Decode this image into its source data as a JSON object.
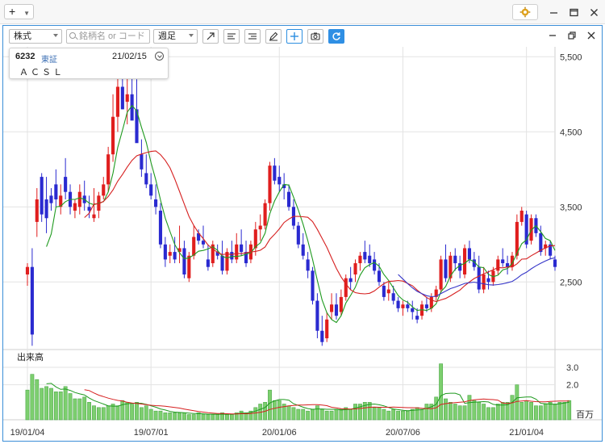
{
  "app": {
    "add_label": "+",
    "colors": {
      "accent": "#3b8ed8",
      "up": "#e01e1e",
      "down": "#2a2ad0",
      "ma_short": "#1f9a1f",
      "ma_mid": "#d62020",
      "ma_long": "#3535c8",
      "volume": "#7dcf6f"
    },
    "icons": [
      "add-icon",
      "chevron-down-icon",
      "gear-icon",
      "minimize-icon",
      "maximize-icon",
      "close-icon"
    ]
  },
  "toolbar": {
    "market_type": "株式",
    "search_placeholder": "銘柄名 or コード",
    "period": "週足",
    "tool_icons": [
      "trend-line-icon",
      "align-left-icon",
      "align-right-icon",
      "pencil-icon",
      "crosshair-icon",
      "camera-icon",
      "refresh-icon"
    ]
  },
  "info": {
    "code": "6232",
    "market": "東証",
    "date": "21/02/15",
    "name": "ＡＣＳＬ"
  },
  "volume_panel": {
    "label": "出来高",
    "unit": "百万",
    "y_ticks": [
      "3.0",
      "2.0"
    ]
  },
  "chart_data": {
    "type": "candlestick",
    "price_axis_ticks": [
      5500,
      4500,
      3500,
      2500
    ],
    "price_axis_labels": [
      "5,500",
      "4,500",
      "3,500",
      "2,500"
    ],
    "price_range": [
      1600,
      5600
    ],
    "x_tick_labels": [
      "19/01/04",
      "19/07/01",
      "20/01/06",
      "20/07/06",
      "21/01/04"
    ],
    "x_tick_index": [
      0,
      26,
      53,
      79,
      105
    ],
    "candles": [
      [
        2600,
        2750,
        2450,
        2700
      ],
      [
        2700,
        2950,
        1650,
        1800
      ],
      [
        3300,
        3750,
        3100,
        3600
      ],
      [
        3900,
        3950,
        3300,
        3400
      ],
      [
        3600,
        3900,
        3150,
        3350
      ],
      [
        3650,
        3750,
        3450,
        3550
      ],
      [
        3800,
        4000,
        3500,
        3600
      ],
      [
        3500,
        3800,
        3400,
        3650
      ],
      [
        3900,
        4150,
        3600,
        3700
      ],
      [
        3700,
        3800,
        3400,
        3500
      ],
      [
        3450,
        3600,
        3350,
        3550
      ],
      [
        3500,
        3800,
        3400,
        3700
      ],
      [
        3650,
        3850,
        3450,
        3550
      ],
      [
        3500,
        3650,
        3350,
        3450
      ],
      [
        3350,
        3750,
        3300,
        3400
      ],
      [
        3450,
        3700,
        3350,
        3650
      ],
      [
        3650,
        3900,
        3600,
        3800
      ],
      [
        3800,
        4300,
        3700,
        4200
      ],
      [
        4200,
        5000,
        4100,
        4700
      ],
      [
        4700,
        5400,
        4500,
        5100
      ],
      [
        5100,
        5600,
        4800,
        4800
      ],
      [
        4900,
        5400,
        4600,
        5000
      ],
      [
        5000,
        5500,
        4700,
        4650
      ],
      [
        4800,
        5200,
        4500,
        4350
      ],
      [
        4200,
        4400,
        3900,
        4000
      ],
      [
        3950,
        4200,
        3750,
        3800
      ],
      [
        3800,
        3950,
        3600,
        3650
      ],
      [
        3600,
        3800,
        3400,
        3500
      ],
      [
        3450,
        3550,
        2950,
        3000
      ],
      [
        3000,
        3100,
        2700,
        2800
      ],
      [
        2850,
        3000,
        2750,
        2900
      ],
      [
        2900,
        3100,
        2750,
        2800
      ],
      [
        2900,
        3250,
        2750,
        2950
      ],
      [
        2950,
        3050,
        2550,
        2600
      ],
      [
        2550,
        2900,
        2500,
        2850
      ],
      [
        2850,
        3250,
        2800,
        3100
      ],
      [
        3150,
        3200,
        3000,
        3050
      ],
      [
        3050,
        3250,
        2950,
        3000
      ],
      [
        2800,
        3000,
        2650,
        2700
      ],
      [
        2750,
        3050,
        2700,
        3000
      ],
      [
        2900,
        3000,
        2800,
        2850
      ],
      [
        2850,
        3050,
        2600,
        2650
      ],
      [
        2650,
        2950,
        2600,
        2900
      ],
      [
        2900,
        3050,
        2750,
        2800
      ],
      [
        2800,
        3150,
        2750,
        3000
      ],
      [
        3000,
        3200,
        2850,
        2900
      ],
      [
        2900,
        3050,
        2700,
        2750
      ],
      [
        2800,
        3050,
        2750,
        3000
      ],
      [
        2950,
        3300,
        2850,
        3200
      ],
      [
        3200,
        3400,
        3050,
        3250
      ],
      [
        3250,
        3600,
        3200,
        3550
      ],
      [
        3550,
        4100,
        3450,
        4050
      ],
      [
        4050,
        4150,
        3800,
        3850
      ],
      [
        3900,
        4050,
        3700,
        3800
      ],
      [
        3800,
        3950,
        3600,
        3750
      ],
      [
        3700,
        3800,
        3450,
        3500
      ],
      [
        3500,
        3600,
        3200,
        3250
      ],
      [
        3250,
        3300,
        2950,
        3000
      ],
      [
        3000,
        3150,
        2800,
        2850
      ],
      [
        2800,
        2900,
        2550,
        2650
      ],
      [
        2650,
        2700,
        2200,
        2250
      ],
      [
        2250,
        2350,
        1750,
        1850
      ],
      [
        1850,
        2050,
        1650,
        1700
      ],
      [
        1750,
        2100,
        1700,
        2000
      ],
      [
        2100,
        2350,
        2000,
        2200
      ],
      [
        2200,
        2350,
        2000,
        2050
      ],
      [
        2100,
        2400,
        2050,
        2300
      ],
      [
        2300,
        2600,
        2250,
        2550
      ],
      [
        2550,
        2700,
        2400,
        2500
      ],
      [
        2600,
        2800,
        2500,
        2750
      ],
      [
        2750,
        2900,
        2650,
        2850
      ],
      [
        2900,
        3050,
        2750,
        2800
      ],
      [
        2850,
        3000,
        2700,
        2750
      ],
      [
        2800,
        2900,
        2600,
        2650
      ],
      [
        2650,
        2750,
        2450,
        2500
      ],
      [
        2450,
        2500,
        2250,
        2300
      ],
      [
        2350,
        2500,
        2250,
        2400
      ],
      [
        2350,
        2450,
        2200,
        2250
      ],
      [
        2250,
        2300,
        2100,
        2150
      ],
      [
        2150,
        2250,
        2050,
        2200
      ],
      [
        2200,
        2250,
        2100,
        2150
      ],
      [
        2150,
        2250,
        2000,
        2100
      ],
      [
        2050,
        2150,
        1950,
        2000
      ],
      [
        2050,
        2250,
        2000,
        2200
      ],
      [
        2200,
        2300,
        2100,
        2150
      ],
      [
        2150,
        2350,
        2100,
        2300
      ],
      [
        2300,
        2450,
        2250,
        2400
      ],
      [
        2400,
        2850,
        2350,
        2800
      ],
      [
        2800,
        3000,
        2500,
        2550
      ],
      [
        2550,
        2900,
        2500,
        2850
      ],
      [
        2850,
        2950,
        2650,
        2750
      ],
      [
        2750,
        2850,
        2550,
        2650
      ],
      [
        2600,
        3000,
        2550,
        2950
      ],
      [
        2950,
        3050,
        2750,
        2800
      ],
      [
        2800,
        2900,
        2650,
        2700
      ],
      [
        2700,
        2850,
        2350,
        2400
      ],
      [
        2400,
        2700,
        2350,
        2600
      ],
      [
        2550,
        2650,
        2400,
        2500
      ],
      [
        2500,
        2700,
        2450,
        2650
      ],
      [
        2650,
        2850,
        2600,
        2800
      ],
      [
        2800,
        2950,
        2700,
        2750
      ],
      [
        2750,
        2850,
        2600,
        2700
      ],
      [
        2700,
        2900,
        2650,
        2850
      ],
      [
        2850,
        3400,
        2800,
        3300
      ],
      [
        3300,
        3500,
        3250,
        3450
      ],
      [
        3400,
        3450,
        2950,
        3000
      ],
      [
        3050,
        3400,
        3000,
        3350
      ],
      [
        3350,
        3400,
        3100,
        3150
      ],
      [
        3150,
        3250,
        2850,
        2900
      ],
      [
        2950,
        3050,
        2850,
        3000
      ],
      [
        3000,
        3050,
        2800,
        2850
      ],
      [
        2800,
        2850,
        2650,
        2700
      ]
    ],
    "volume": [
      1.7,
      2.6,
      2.3,
      1.8,
      1.9,
      1.8,
      1.6,
      1.6,
      1.9,
      1.5,
      1.2,
      1.2,
      1.3,
      1.0,
      0.8,
      0.7,
      0.7,
      0.8,
      0.9,
      0.8,
      1.1,
      1.0,
      0.9,
      1.0,
      0.7,
      0.8,
      0.6,
      0.5,
      0.5,
      0.4,
      0.4,
      0.4,
      0.4,
      0.4,
      0.3,
      0.3,
      0.4,
      0.3,
      0.3,
      0.3,
      0.3,
      0.4,
      0.3,
      0.3,
      0.4,
      0.5,
      0.4,
      0.5,
      0.7,
      0.9,
      1.0,
      1.7,
      1.1,
      1.1,
      0.9,
      0.8,
      0.7,
      0.6,
      0.6,
      0.5,
      0.6,
      0.8,
      0.6,
      0.5,
      0.5,
      0.6,
      0.6,
      0.7,
      0.6,
      0.9,
      0.9,
      1.0,
      1.0,
      0.7,
      0.7,
      0.6,
      0.5,
      0.6,
      0.5,
      0.5,
      0.5,
      0.6,
      0.7,
      0.6,
      0.9,
      0.9,
      1.3,
      3.2,
      1.2,
      1.0,
      0.9,
      0.8,
      0.8,
      1.4,
      1.1,
      1.0,
      0.9,
      0.7,
      0.7,
      0.9,
      1.0,
      1.0,
      1.4,
      2.0,
      1.0,
      1.1,
      1.0,
      0.8,
      0.8,
      0.9,
      1.0,
      0.9,
      1.0,
      1.0,
      1.1
    ],
    "volume_range": [
      0,
      3.6
    ],
    "moving_averages": [
      {
        "period": 5,
        "color": "#1f9a1f"
      },
      {
        "period": 13,
        "color": "#d62020"
      },
      {
        "period": 26,
        "color": "#3535c8"
      }
    ],
    "grid": true
  }
}
